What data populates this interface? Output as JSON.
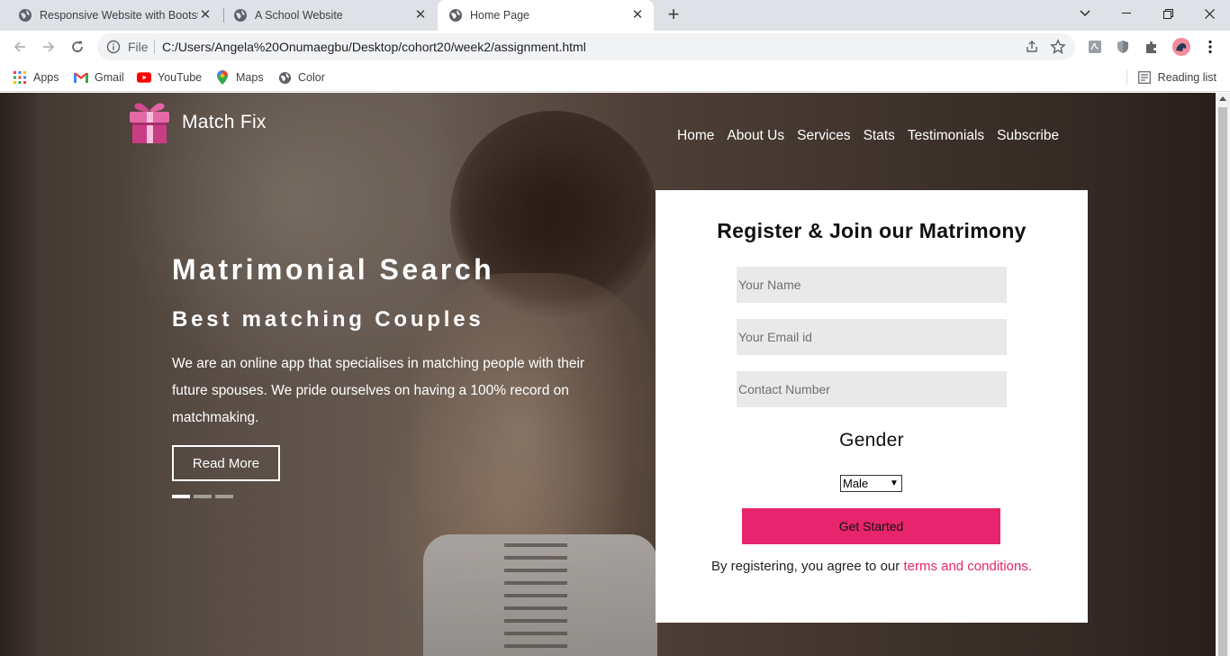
{
  "browser": {
    "tabs": [
      {
        "title": "Responsive Website with Bootstr",
        "active": false
      },
      {
        "title": "A School Website",
        "active": false
      },
      {
        "title": "Home Page",
        "active": true
      }
    ],
    "omnibox": {
      "scheme_label": "File",
      "url": "C:/Users/Angela%20Onumaegbu/Desktop/cohort20/week2/assignment.html"
    },
    "bookmarks": [
      {
        "label": "Apps",
        "icon": "apps-grid-icon"
      },
      {
        "label": "Gmail",
        "icon": "gmail-icon"
      },
      {
        "label": "YouTube",
        "icon": "youtube-icon"
      },
      {
        "label": "Maps",
        "icon": "maps-pin-icon"
      },
      {
        "label": "Color",
        "icon": "globe-icon"
      }
    ],
    "reading_list": "Reading list"
  },
  "page": {
    "brand": "Match Fix",
    "nav": [
      "Home",
      "About Us",
      "Services",
      "Stats",
      "Testimonials",
      "Subscribe"
    ],
    "hero": {
      "title": "Matrimonial Search",
      "subtitle": "Best matching Couples",
      "description": "We are an online app that specialises in matching people with their future spouses. We pride ourselves on having a 100% record on matchmaking.",
      "cta": "Read More",
      "slides": 3,
      "active_slide": 1
    },
    "form": {
      "title": "Register & Join our Matrimony",
      "name_placeholder": "Your Name",
      "email_placeholder": "Your Email id",
      "contact_placeholder": "Contact Number",
      "gender_title": "Gender",
      "gender_value": "Male",
      "submit": "Get Started",
      "terms_prefix": "By registering, you agree to our",
      "terms_link": "terms and conditions."
    }
  },
  "colors": {
    "accent": "#e8246c",
    "tabstrip": "#dee1e6"
  }
}
